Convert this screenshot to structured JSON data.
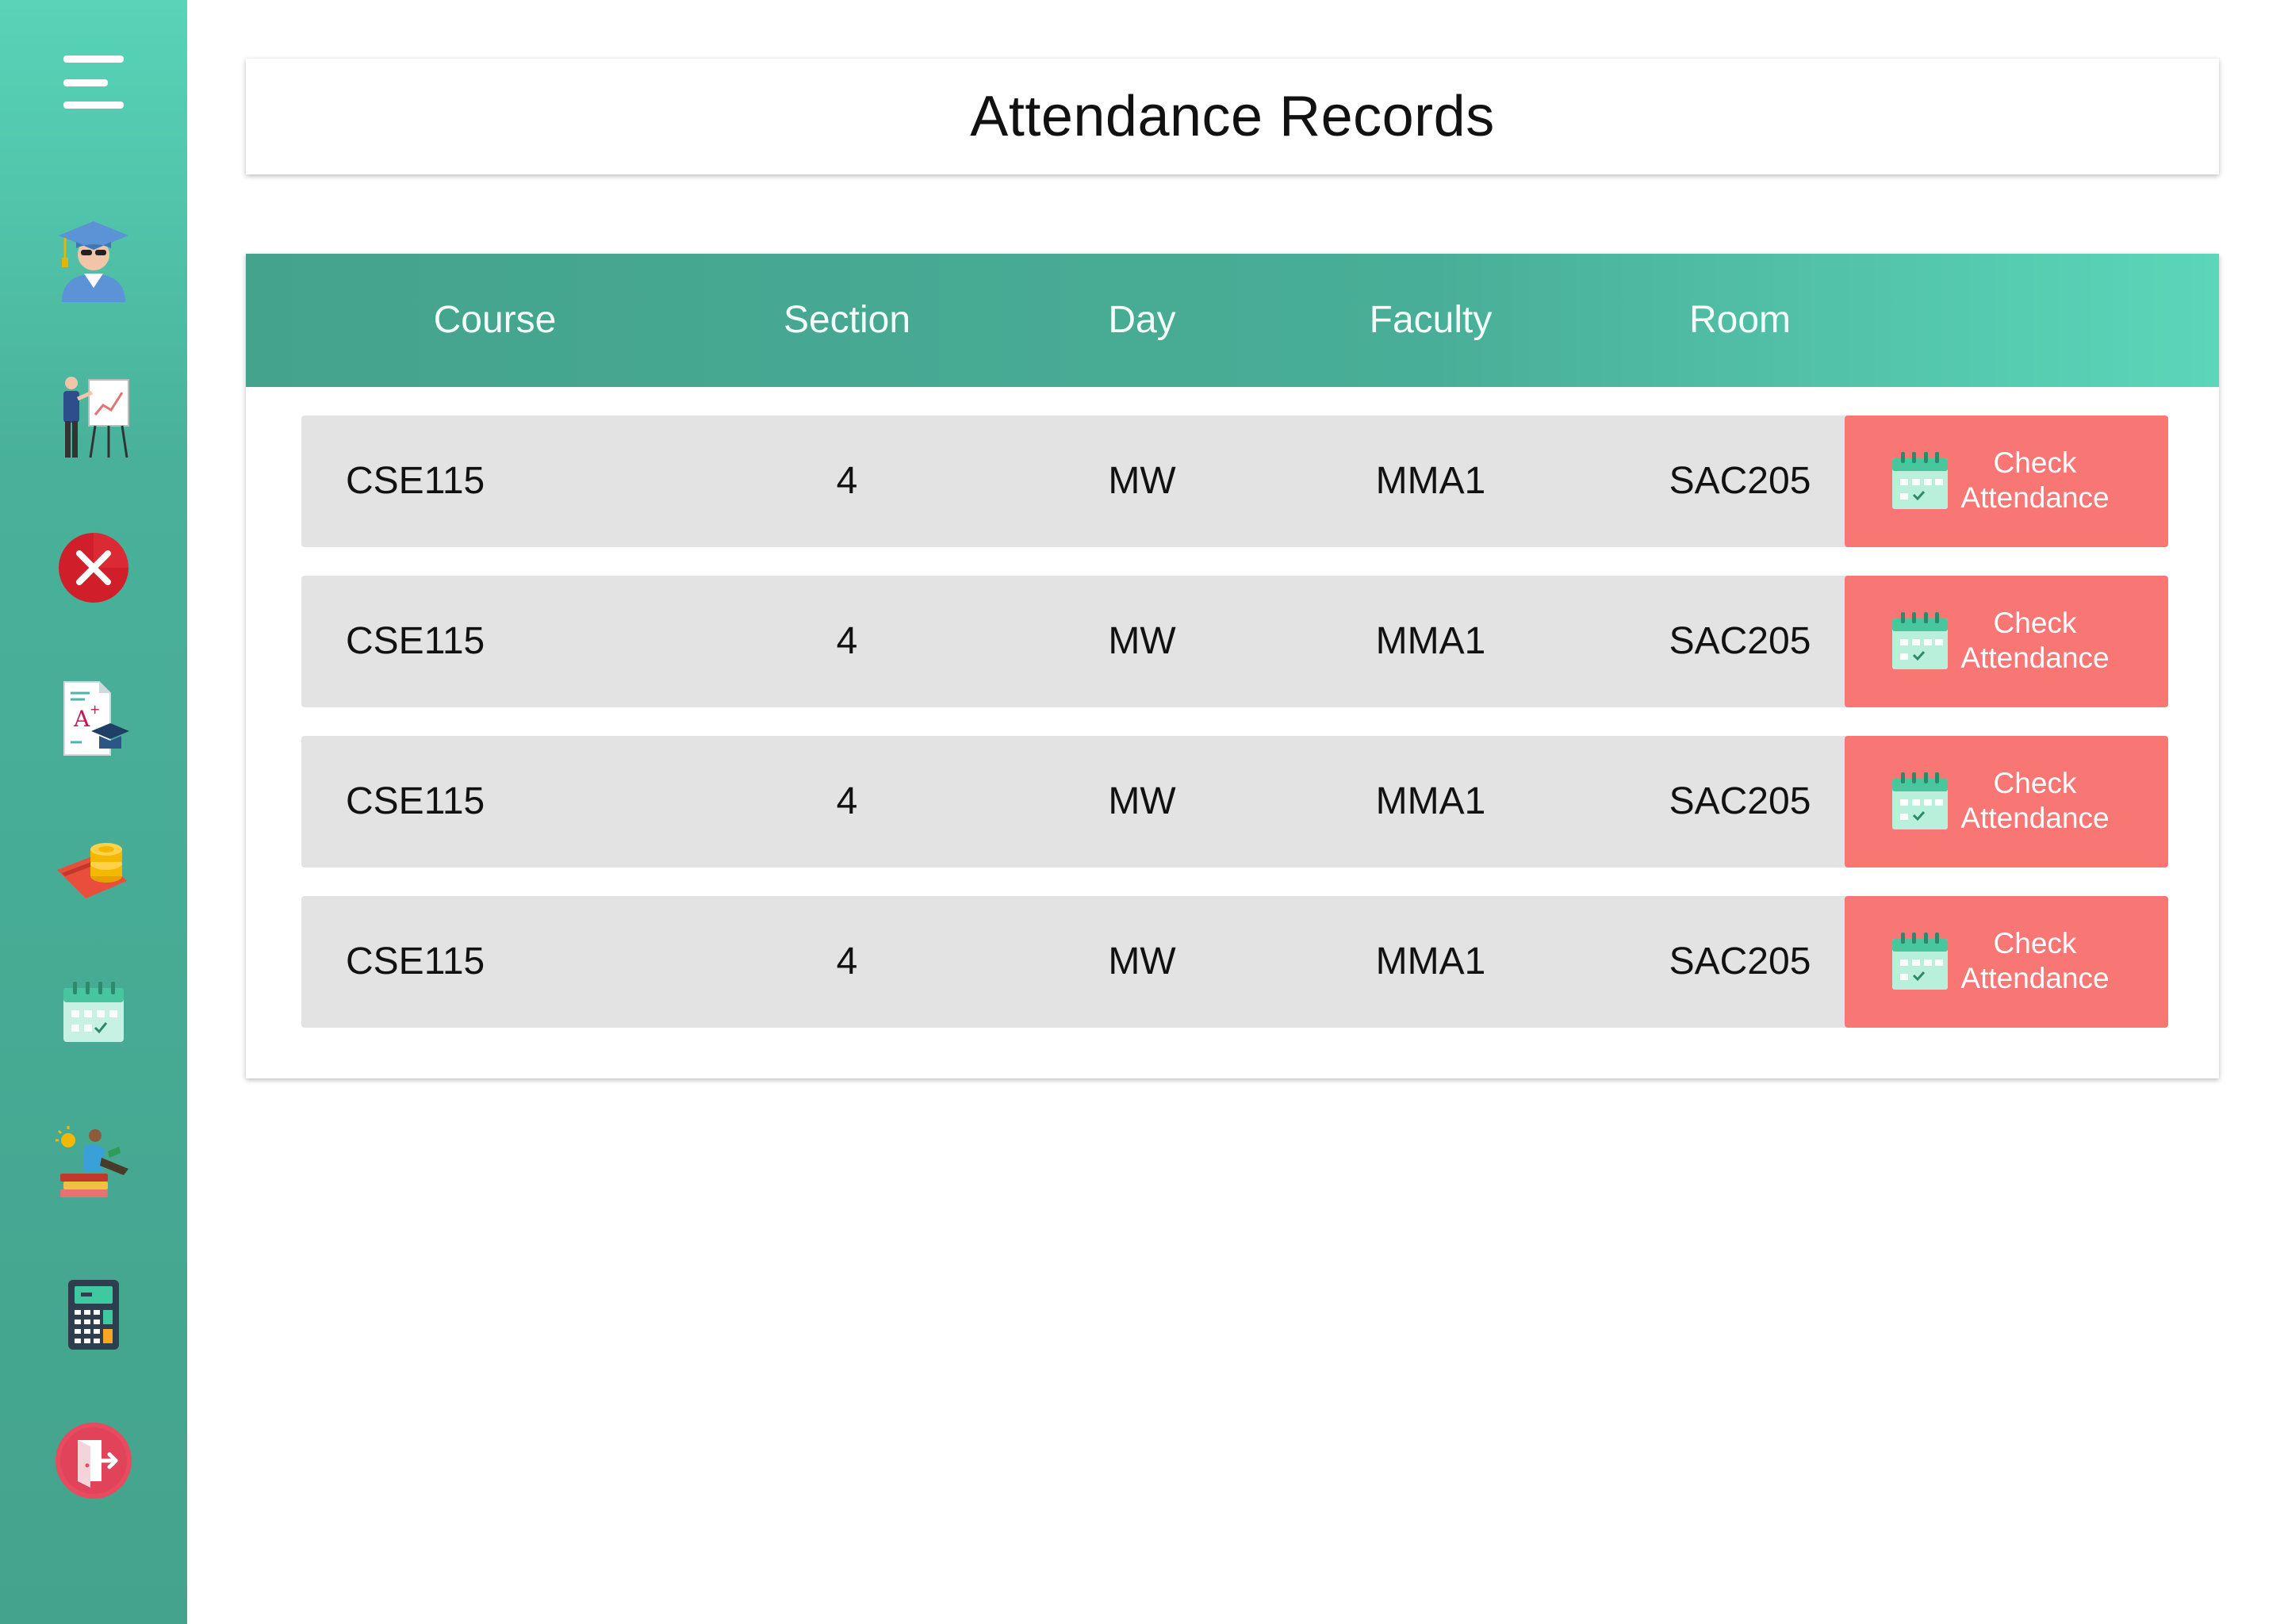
{
  "sidebar": {
    "items": [
      {
        "name": "menu-icon"
      },
      {
        "name": "graduate-icon"
      },
      {
        "name": "teacher-presentation-icon"
      },
      {
        "name": "cancel-icon"
      },
      {
        "name": "grade-report-icon"
      },
      {
        "name": "payment-icon"
      },
      {
        "name": "calendar-icon"
      },
      {
        "name": "reading-student-icon"
      },
      {
        "name": "calculator-icon"
      },
      {
        "name": "logout-icon"
      }
    ]
  },
  "page": {
    "title": "Attendance Records"
  },
  "table": {
    "headers": [
      "Course",
      "Section",
      "Day",
      "Faculty",
      "Room"
    ],
    "rows": [
      {
        "course": "CSE115",
        "section": "4",
        "day": "MW",
        "faculty": "MMA1",
        "room": "SAC205",
        "action": "Check\nAttendance"
      },
      {
        "course": "CSE115",
        "section": "4",
        "day": "MW",
        "faculty": "MMA1",
        "room": "SAC205",
        "action": "Check\nAttendance"
      },
      {
        "course": "CSE115",
        "section": "4",
        "day": "MW",
        "faculty": "MMA1",
        "room": "SAC205",
        "action": "Check\nAttendance"
      },
      {
        "course": "CSE115",
        "section": "4",
        "day": "MW",
        "faculty": "MMA1",
        "room": "SAC205",
        "action": "Check\nAttendance"
      }
    ]
  },
  "colors": {
    "sidebar_top": "#58d4b8",
    "sidebar_bottom": "#44a38d",
    "header_start": "#44a38d",
    "header_end": "#5bd6ba",
    "row_bg": "#e3e3e3",
    "button_bg": "#f87674"
  }
}
